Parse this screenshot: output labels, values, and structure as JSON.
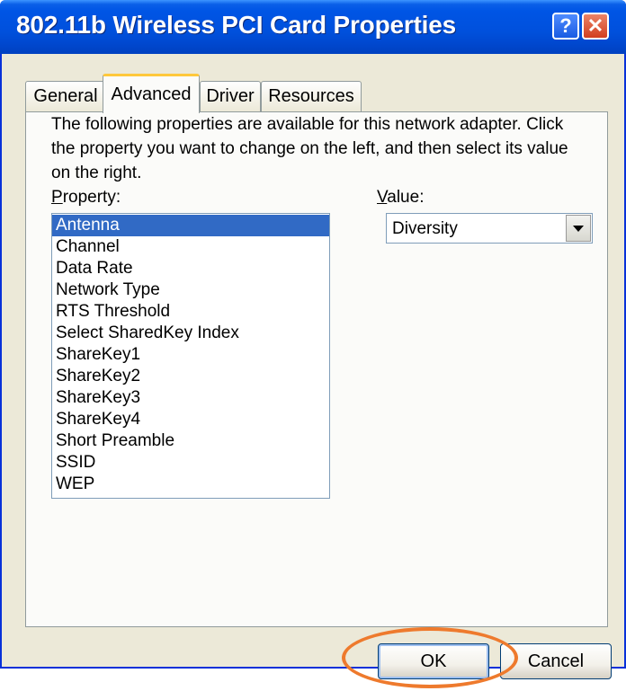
{
  "window": {
    "title": "802.11b Wireless PCI Card Properties",
    "help_icon": "?",
    "close_icon": "✕"
  },
  "tabs": [
    {
      "label": "General"
    },
    {
      "label": "Advanced",
      "active": true
    },
    {
      "label": "Driver"
    },
    {
      "label": "Resources"
    }
  ],
  "advanced": {
    "description": "The following properties are available for this network adapter. Click the property you want to change on the left, and then select its value on the right.",
    "property_label": "Property:",
    "value_label": "Value:",
    "properties": [
      "Antenna",
      "Channel",
      "Data Rate",
      "Network Type",
      "RTS Threshold",
      "Select SharedKey Index",
      "ShareKey1",
      "ShareKey2",
      "ShareKey3",
      "ShareKey4",
      "Short Preamble",
      "SSID",
      "WEP"
    ],
    "selected_property": "Antenna",
    "value": "Diversity"
  },
  "buttons": {
    "ok": "OK",
    "cancel": "Cancel"
  },
  "colors": {
    "titlebar": "#0055e5",
    "selection": "#316ac5",
    "highlight_circle": "#ee7a2d"
  }
}
